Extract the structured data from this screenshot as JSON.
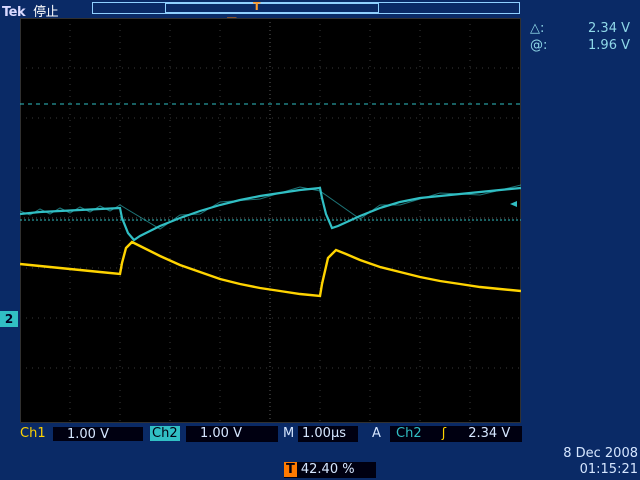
{
  "header": {
    "brand": "Tek",
    "status": "停止"
  },
  "readout": {
    "delta_symbol": "△:",
    "delta_value": "2.34 V",
    "at_symbol": "@:",
    "at_value": "1.96 V"
  },
  "markers": {
    "trigger": "T",
    "ch2": "2"
  },
  "channels": {
    "ch1_label": "Ch1",
    "ch1_scale": "1.00 V",
    "ch2_label": "Ch2",
    "ch2_scale": "1.00 V"
  },
  "horizontal": {
    "m_label": "M",
    "scale": "1.00µs"
  },
  "trigger": {
    "a_label": "A",
    "source": "Ch2",
    "slope_symbol": "ʃ",
    "level": "2.34 V",
    "position": "42.40 %"
  },
  "datetime": {
    "date": "8 Dec  2008",
    "time": "01:15:21"
  },
  "colors": {
    "ch1": "#ffd400",
    "ch2": "#31bfc4",
    "trigger": "#ff7a00",
    "frame": "#0a2a66"
  }
}
